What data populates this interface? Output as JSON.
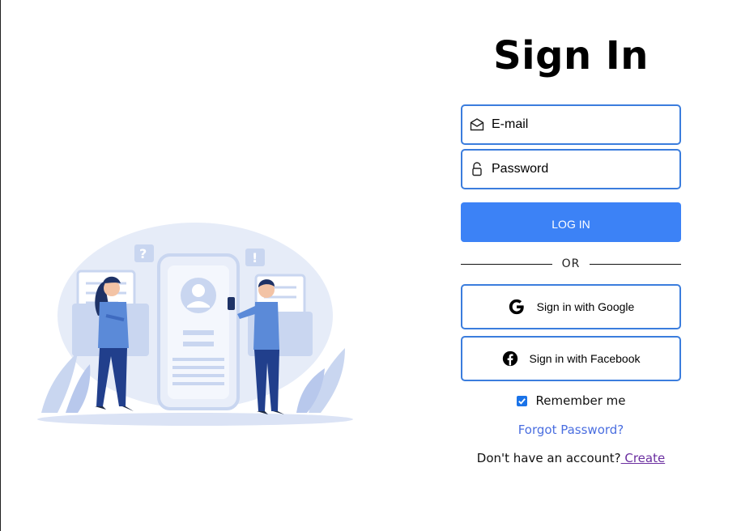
{
  "heading": "Sign In",
  "email": {
    "placeholder": "E-mail",
    "icon": "envelope-icon"
  },
  "password": {
    "placeholder": "Password",
    "icon": "lock-icon"
  },
  "login_label": "LOG IN",
  "divider_text": "OR",
  "google_label": "Sign in with Google",
  "facebook_label": "Sign in with Facebook",
  "remember": {
    "label": "Remember me",
    "checked": true
  },
  "forgot_label": "Forgot Password?",
  "signup": {
    "prompt": "Don't have an account?",
    "link_label": " Create"
  },
  "colors": {
    "accent": "#3c82f6",
    "field_border": "#3b7ddd",
    "link": "#4a6ee0",
    "visited_link": "#6b2fa0"
  }
}
